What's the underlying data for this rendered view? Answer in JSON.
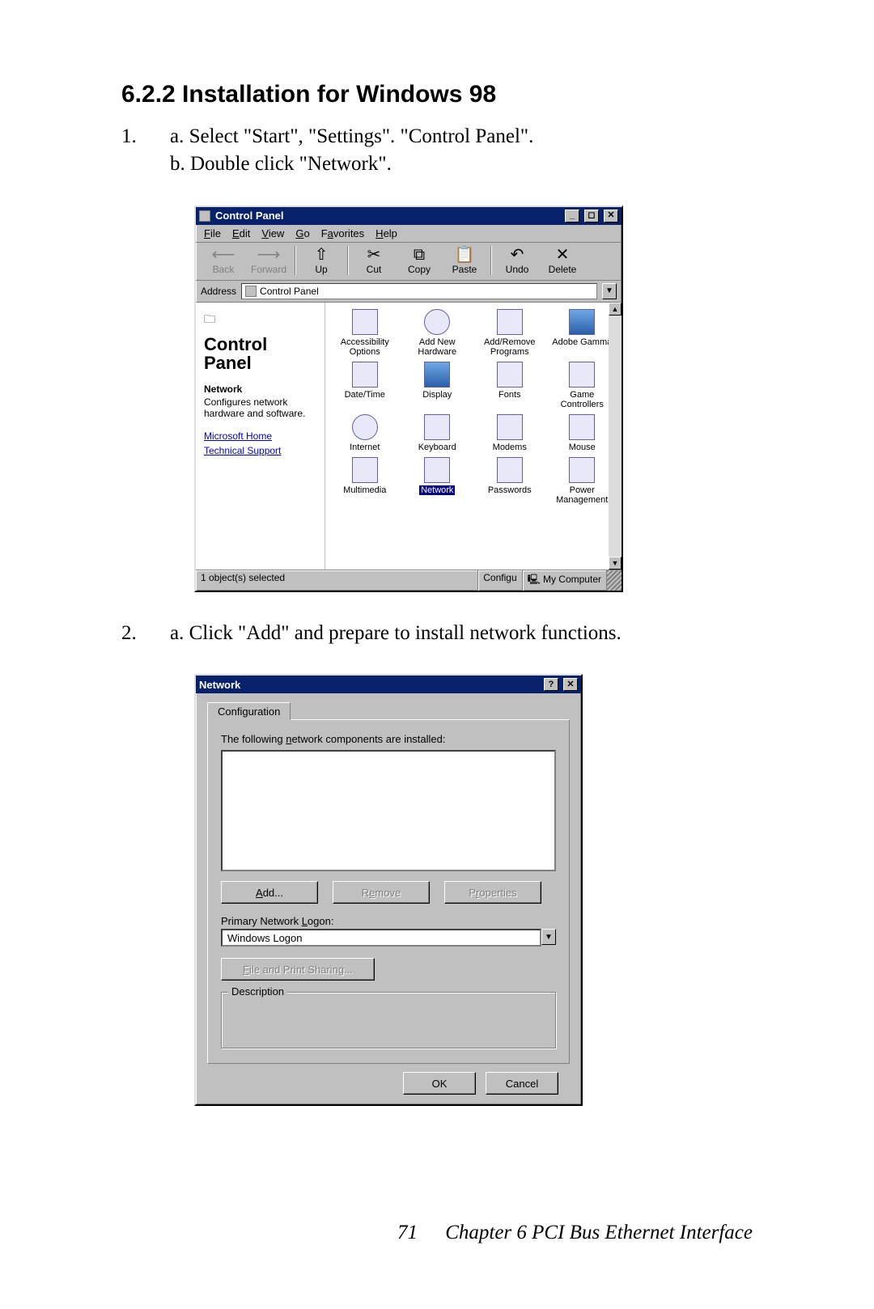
{
  "doc": {
    "heading": "6.2.2 Installation for Windows 98",
    "step1_num": "1.",
    "step1_a": "a. Select \"Start\", \"Settings\". \"Control Panel\".",
    "step1_b": "b. Double click \"Network\".",
    "step2_num": "2.",
    "step2_a": "a. Click \"Add\" and prepare to install network functions.",
    "page_num": "71",
    "footer": "Chapter 6  PCI Bus Ethernet Interface"
  },
  "cp": {
    "title": "Control Panel",
    "menu": {
      "file": "File",
      "edit": "Edit",
      "view": "View",
      "go": "Go",
      "favorites": "Favorites",
      "help": "Help"
    },
    "tb": {
      "back": "Back",
      "forward": "Forward",
      "up": "Up",
      "cut": "Cut",
      "copy": "Copy",
      "paste": "Paste",
      "undo": "Undo",
      "delete": "Delete"
    },
    "addr_label": "Address",
    "addr_value": "Control Panel",
    "left": {
      "title": "Control Panel",
      "selected": "Network",
      "desc": "Configures network hardware and software.",
      "link1": "Microsoft Home",
      "link2": "Technical Support"
    },
    "icons": [
      {
        "label": "Accessibility Options"
      },
      {
        "label": "Add New Hardware"
      },
      {
        "label": "Add/Remove Programs"
      },
      {
        "label": "Adobe Gamma"
      },
      {
        "label": "Date/Time"
      },
      {
        "label": "Display"
      },
      {
        "label": "Fonts"
      },
      {
        "label": "Game Controllers"
      },
      {
        "label": "Internet"
      },
      {
        "label": "Keyboard"
      },
      {
        "label": "Modems"
      },
      {
        "label": "Mouse"
      },
      {
        "label": "Multimedia"
      },
      {
        "label": "Network"
      },
      {
        "label": "Passwords"
      },
      {
        "label": "Power Management"
      }
    ],
    "status_left": "1 object(s) selected",
    "status_mid": "Configu",
    "status_right": "My Computer"
  },
  "net": {
    "title": "Network",
    "tab": "Configuration",
    "list_label": "The following network components are installed:",
    "btn_add": "Add...",
    "btn_remove": "Remove",
    "btn_props": "Properties",
    "logon_label": "Primary Network Logon:",
    "logon_value": "Windows Logon",
    "file_share": "File and Print Sharing...",
    "desc_legend": "Description",
    "ok": "OK",
    "cancel": "Cancel"
  }
}
